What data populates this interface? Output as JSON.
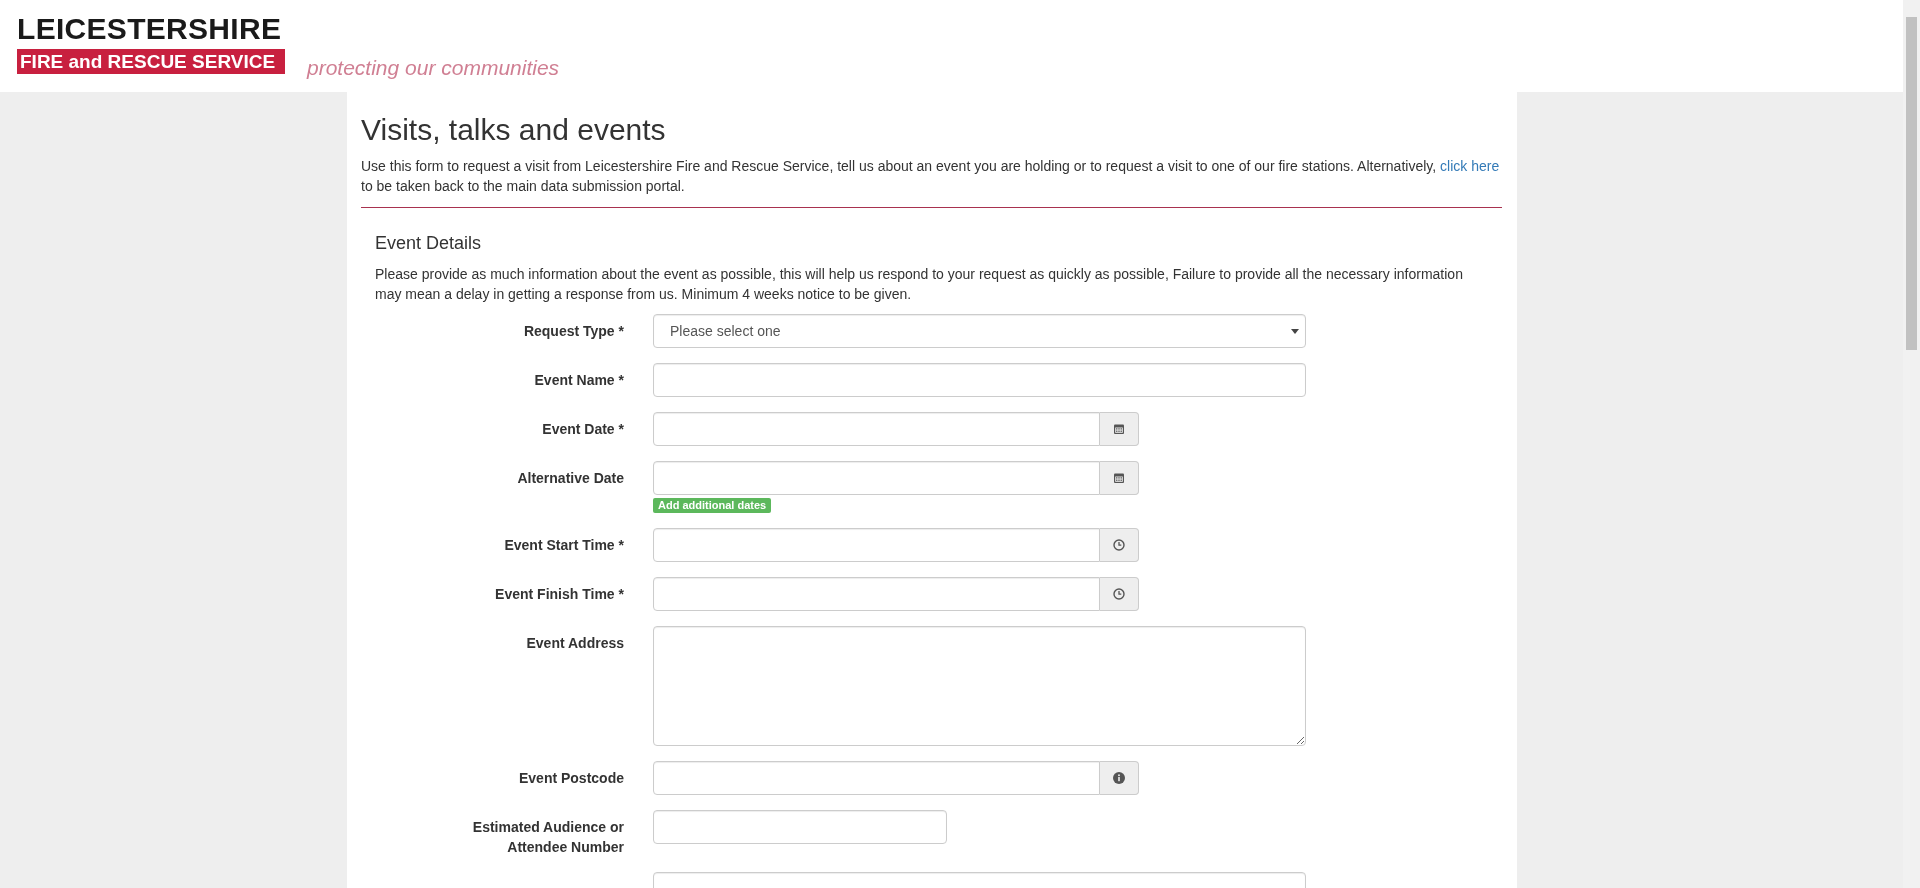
{
  "header": {
    "logo_top": "LEICESTERSHIRE",
    "logo_bar": "FIRE and RESCUE SERVICE",
    "tagline": "protecting our communities"
  },
  "page": {
    "title": "Visits, talks and events",
    "intro": "Use this form to request a visit from Leicestershire Fire and Rescue Service, tell us about an event you are holding or to request a visit to one of our fire stations. Alternatively,",
    "intro_link": "click here",
    "intro_end": "to be taken back to the main data submission portal."
  },
  "section": {
    "title": "Event Details",
    "description": "Please provide as much information about the event as possible, this will help us respond to your request as quickly as possible, Failure to provide all the necessary information may mean a delay in getting a response from us. Minimum 4 weeks notice to be given."
  },
  "fields": [
    {
      "label": "Request Type *",
      "kind": "select",
      "placeholder": "Please select one"
    },
    {
      "label": "Event Name *",
      "kind": "text"
    },
    {
      "label": "Event Date *",
      "kind": "date"
    },
    {
      "label": "Alternative Date",
      "kind": "date",
      "badge": "Add additional dates"
    },
    {
      "label": "Event Start Time *",
      "kind": "time"
    },
    {
      "label": "Event Finish Time *",
      "kind": "time"
    },
    {
      "label": "Event Address",
      "kind": "textarea"
    },
    {
      "label": "Event Postcode",
      "kind": "info"
    },
    {
      "label": "Estimated Audience or Attendee Number",
      "kind": "short"
    },
    {
      "kind": "text"
    }
  ]
}
